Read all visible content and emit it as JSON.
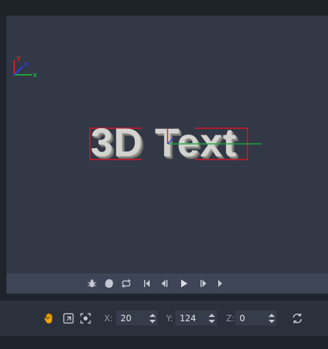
{
  "viewport": {
    "scene_text": "3D Text",
    "axis_labels": {
      "x": "x",
      "y": "y",
      "z": "z"
    },
    "colors": {
      "x_axis": "#1fa83a",
      "y_axis": "#d21f2b",
      "z_axis": "#2b3fe0",
      "selection": "#b51d2a"
    }
  },
  "playback": {
    "icons": [
      "bug-icon",
      "blob-icon",
      "loop-icon",
      "skip-to-start-icon",
      "step-back-icon",
      "play-icon",
      "step-forward-icon",
      "skip-to-end-icon"
    ]
  },
  "toolbar": {
    "icons": [
      "hand-pan-icon",
      "fit-frame-icon",
      "focus-selection-icon",
      "sync-refresh-icon"
    ],
    "x_label": "X:",
    "x_value": "20",
    "y_label": "Y:",
    "y_value": "124",
    "z_label": "Z:",
    "z_value": "0",
    "accent": "#f0a500"
  }
}
